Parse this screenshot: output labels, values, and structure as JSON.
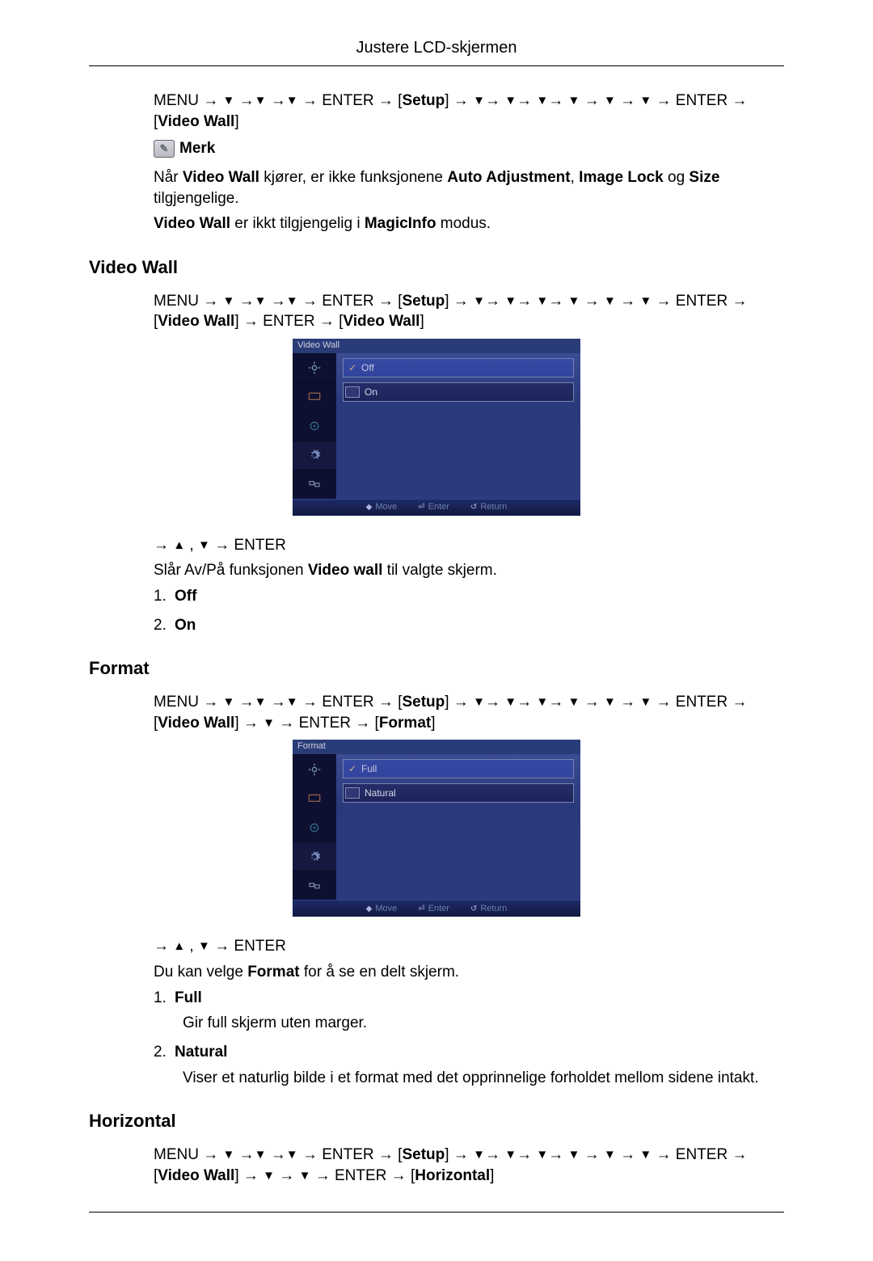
{
  "page": {
    "header": "Justere LCD-skjermen"
  },
  "intro": {
    "nav_intro": "MENU → ▼ →▼ →▼ → ENTER → [Setup] → ▼→ ▼→ ▼→ ▼ → ▼ → ▼ → ENTER → [Video Wall]",
    "note_label": "Merk",
    "note_text_pre": "Når ",
    "note_b_vw": "Video Wall",
    "note_text_mid": " kjører, er ikke funksjonene ",
    "note_b_auto": "Auto Adjustment",
    "note_text_sep": ", ",
    "note_b_img": "Image Lock",
    "note_text_and": " og ",
    "note_b_size": "Size",
    "note_text_end": " tilgjengelige.",
    "note_line2_pre": "Video Wall",
    "note_line2_mid": " er ikkt tilgjengelig i ",
    "note_b_magic": "MagicInfo",
    "note_line2_end": " modus."
  },
  "section_videowall": {
    "title": "Video Wall",
    "nav": "MENU → ▼ →▼ →▼ → ENTER → [Setup] → ▼→ ▼→ ▼→ ▼ → ▼ → ▼ → ENTER → [Video Wall] → ENTER → [Video Wall]",
    "osd_title": "Video Wall",
    "option1": "Off",
    "option2": "On",
    "footer_move": "Move",
    "footer_enter": "Enter",
    "footer_return": "Return",
    "after_img": "→ ▲ , ▼ → ENTER",
    "desc_pre": "Slår Av/På funksjonen ",
    "desc_bold": "Video wall",
    "desc_post": " til valgte skjerm.",
    "li1": "Off",
    "li2": "On"
  },
  "section_format": {
    "title": "Format",
    "nav": "MENU → ▼ →▼ →▼ → ENTER → [Setup] → ▼→ ▼→ ▼→ ▼ → ▼ → ▼ → ENTER → [Video Wall] → ▼ → ENTER → [Format]",
    "osd_title": "Format",
    "option1": "Full",
    "option2": "Natural",
    "footer_move": "Move",
    "footer_enter": "Enter",
    "footer_return": "Return",
    "after_img": "→ ▲ , ▼ → ENTER",
    "desc_pre": "Du kan velge ",
    "desc_bold": "Format",
    "desc_post": " for å se en delt skjerm.",
    "li1": "Full",
    "li1_desc": "Gir full skjerm uten marger.",
    "li2": "Natural",
    "li2_desc": "Viser et naturlig bilde i et format med det opprinnelige forholdet mellom sidene intakt."
  },
  "section_horizontal": {
    "title": "Horizontal",
    "nav": "MENU → ▼ →▼ →▼ → ENTER → [Setup] → ▼→ ▼→ ▼→ ▼ → ▼ → ▼ → ENTER → [Video Wall] → ▼ → ▼ → ENTER → [Horizontal]"
  }
}
